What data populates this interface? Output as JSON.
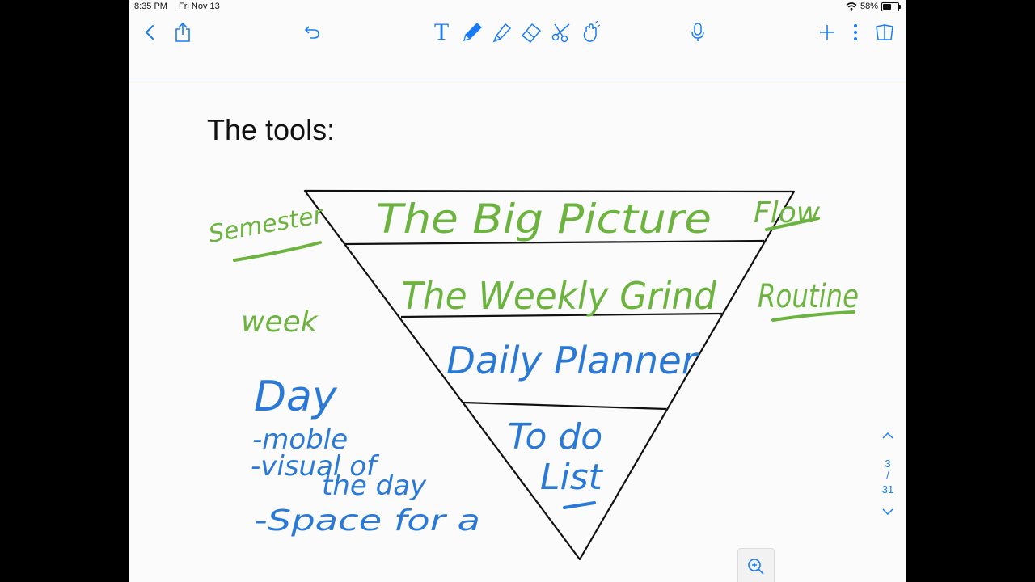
{
  "status_bar": {
    "time": "8:35 PM",
    "date": "Fri Nov 13",
    "battery": "58%",
    "battery_level": 0.58
  },
  "toolbar": {
    "icons": [
      "back-chevron-icon",
      "share-icon",
      "undo-icon",
      "text-tool-icon",
      "pen-tool-icon",
      "highlighter-tool-icon",
      "eraser-tool-icon",
      "lasso-scissors-icon",
      "laser-pointer-icon",
      "microphone-icon",
      "add-icon",
      "more-icon",
      "page-thumbnails-icon"
    ],
    "text_tool_label": "T",
    "accent": "#1a7cf5"
  },
  "page": {
    "title": "The tools:",
    "pyramid": {
      "levels": [
        {
          "label": "The Big Picture",
          "left_note": "Semester",
          "right_note": "Flow",
          "ink": "#6cb43f"
        },
        {
          "label": "The Weekly Grind",
          "left_note": "week",
          "right_note": "Routine",
          "ink": "#6cb43f"
        },
        {
          "label": "Daily Planner",
          "ink": "#2a79d6"
        },
        {
          "label": "To do List",
          "ink": "#2a79d6"
        }
      ],
      "to_do_lines": [
        "To do",
        "List"
      ]
    },
    "day_notes": {
      "heading": "Day",
      "bullets": [
        "-moble",
        "-visual of",
        "the day",
        "-Space for a"
      ],
      "ink": "#2a79d6"
    }
  },
  "pager": {
    "current": "3",
    "separator": "/",
    "total": "31"
  }
}
